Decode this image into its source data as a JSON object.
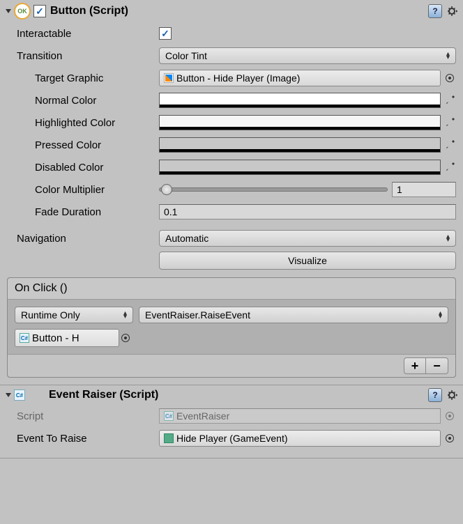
{
  "button_component": {
    "ok_badge": "OK",
    "title": "Button (Script)",
    "enabled": true,
    "fields": {
      "interactable_label": "Interactable",
      "interactable": true,
      "transition_label": "Transition",
      "transition_value": "Color Tint",
      "target_graphic_label": "Target Graphic",
      "target_graphic_value": "Button - Hide Player (Image)",
      "normal_color_label": "Normal Color",
      "normal_color": "#ffffff",
      "normal_alpha": 100,
      "highlighted_color_label": "Highlighted Color",
      "highlighted_color": "#f5f5f5",
      "highlighted_alpha": 100,
      "pressed_color_label": "Pressed Color",
      "pressed_color": "#c8c8c8",
      "pressed_alpha": 100,
      "disabled_color_label": "Disabled Color",
      "disabled_color": "#c8c8c8",
      "disabled_alpha": 50,
      "color_multiplier_label": "Color Multiplier",
      "color_multiplier_value": "1",
      "fade_duration_label": "Fade Duration",
      "fade_duration_value": "0.1",
      "navigation_label": "Navigation",
      "navigation_value": "Automatic",
      "visualize_label": "Visualize"
    },
    "event": {
      "title": "On Click ()",
      "call_state": "Runtime Only",
      "method": "EventRaiser.RaiseEvent",
      "target_object": "Button - H",
      "plus": "+",
      "minus": "−"
    }
  },
  "event_raiser_component": {
    "title": "Event Raiser (Script)",
    "script_label": "Script",
    "script_value": "EventRaiser",
    "event_to_raise_label": "Event To Raise",
    "event_to_raise_value": "Hide Player (GameEvent)"
  }
}
